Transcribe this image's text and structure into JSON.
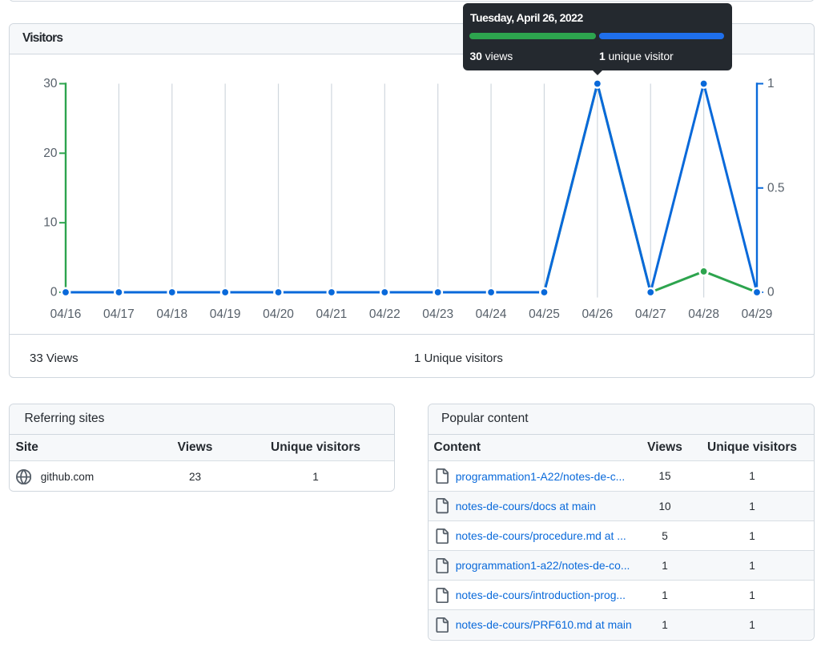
{
  "colors": {
    "views_green": "#2da44e",
    "unique_blue": "#0969da",
    "tooltip_bar_blue": "#1f6feb",
    "panel_border": "#d0d7de",
    "row_border": "#d8dee4",
    "header_bg": "#f6f8fa",
    "text": "#24292f",
    "muted_text": "#57606a",
    "link": "#0969da",
    "gridline": "#d0d7de",
    "tooltip_bg": "#24292f"
  },
  "visitors_panel": {
    "title": "Visitors",
    "summary_views": "33 Views",
    "summary_unique": "1 Unique visitors"
  },
  "tooltip": {
    "date": "Tuesday, April 26, 2022",
    "views_value": "30",
    "views_label": "views",
    "unique_value": "1",
    "unique_label": "unique visitor"
  },
  "chart_data": {
    "type": "line",
    "x": [
      "04/16",
      "04/17",
      "04/18",
      "04/19",
      "04/20",
      "04/21",
      "04/22",
      "04/23",
      "04/24",
      "04/25",
      "04/26",
      "04/27",
      "04/28",
      "04/29"
    ],
    "series": [
      {
        "name": "views",
        "color": "#2da44e",
        "axis": "left",
        "values": [
          0,
          0,
          0,
          0,
          0,
          0,
          0,
          0,
          0,
          0,
          30,
          0,
          3,
          0
        ]
      },
      {
        "name": "unique visitors",
        "color": "#0969da",
        "axis": "right",
        "values": [
          0,
          0,
          0,
          0,
          0,
          0,
          0,
          0,
          0,
          0,
          1,
          0,
          1,
          0
        ]
      }
    ],
    "left_axis": {
      "ticks": [
        0,
        10,
        20,
        30
      ],
      "labels": [
        "0",
        "10",
        "20",
        "30"
      ],
      "max": 30,
      "color": "#2da44e"
    },
    "right_axis": {
      "ticks": [
        0,
        0.5,
        1
      ],
      "labels": [
        "0",
        "0.5",
        "1"
      ],
      "max": 1,
      "color": "#0969da"
    },
    "grid": true,
    "legend": "none",
    "highlighted_point": {
      "x": "04/26",
      "views": 30,
      "unique": 1
    }
  },
  "referring_sites": {
    "title": "Referring sites",
    "columns": [
      "Site",
      "Views",
      "Unique visitors"
    ],
    "rows": [
      {
        "site": "github.com",
        "icon": "globe-icon",
        "views": "23",
        "unique": "1"
      }
    ]
  },
  "popular_content": {
    "title": "Popular content",
    "columns": [
      "Content",
      "Views",
      "Unique visitors"
    ],
    "rows": [
      {
        "path": "programmation1-A22/notes-de-c...",
        "views": "15",
        "unique": "1"
      },
      {
        "path": "notes-de-cours/docs at main",
        "views": "10",
        "unique": "1"
      },
      {
        "path": "notes-de-cours/procedure.md at ...",
        "views": "5",
        "unique": "1"
      },
      {
        "path": "programmation1-a22/notes-de-co...",
        "views": "1",
        "unique": "1"
      },
      {
        "path": "notes-de-cours/introduction-prog...",
        "views": "1",
        "unique": "1"
      },
      {
        "path": "notes-de-cours/PRF610.md at main",
        "views": "1",
        "unique": "1"
      }
    ]
  }
}
